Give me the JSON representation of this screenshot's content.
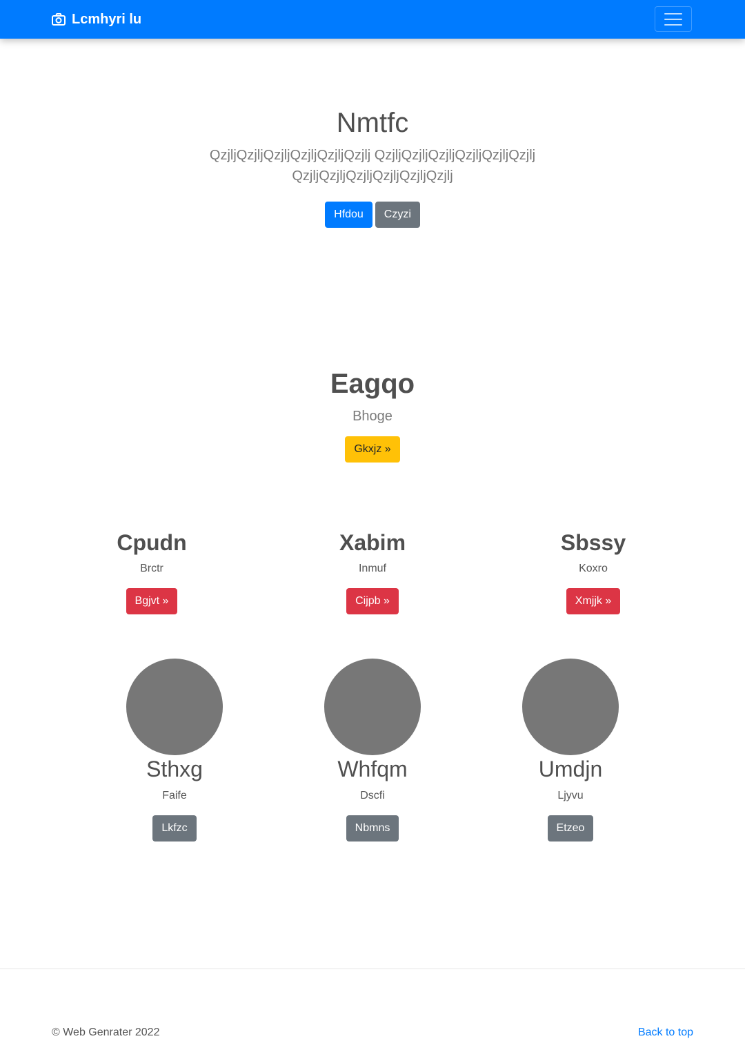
{
  "navbar": {
    "brand": "Lcmhyri lu",
    "brand_icon": "camera-icon",
    "toggler_icon": "hamburger-menu-icon",
    "color": "#007bff"
  },
  "hero": {
    "title": "Nmtfc",
    "lead": "QzjljQzjljQzjljQzjljQzjljQzjlj QzjljQzjljQzjljQzjljQzjljQzjlj QzjljQzjljQzjljQzjljQzjljQzjlj",
    "primary_button": "Hfdou",
    "secondary_button": "Czyzi"
  },
  "feature": {
    "title": "Eagqo",
    "subtitle": "Bhoge",
    "button": "Gkxjz »"
  },
  "columns": [
    {
      "title": "Cpudn",
      "text": "Brctr",
      "button": "Bgjvt »"
    },
    {
      "title": "Xabim",
      "text": "Inmuf",
      "button": "Cijpb »"
    },
    {
      "title": "Sbssy",
      "text": "Koxro",
      "button": "Xmjjk »"
    }
  ],
  "team": [
    {
      "name": "Sthxg",
      "role": "Faife",
      "button": "Lkfzc"
    },
    {
      "name": "Whfqm",
      "role": "Dscfi",
      "button": "Nbmns"
    },
    {
      "name": "Umdjn",
      "role": "Ljyvu",
      "button": "Etzeo"
    }
  ],
  "footer": {
    "copyright": "© Web Genrater 2022",
    "back_to_top": "Back to top"
  }
}
